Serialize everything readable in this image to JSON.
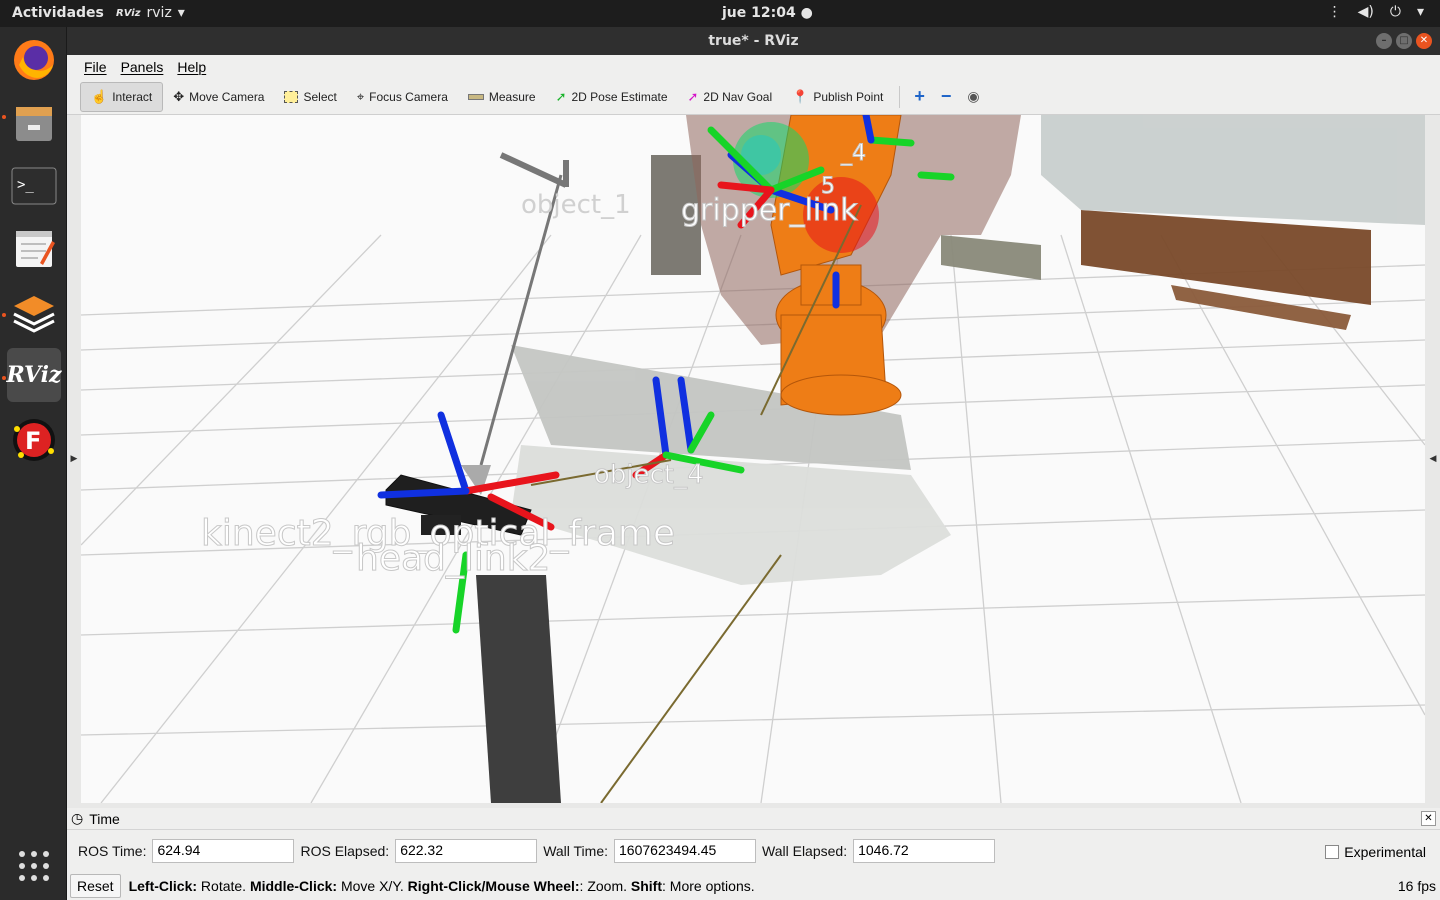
{
  "topbar": {
    "activities": "Actividades",
    "app_name": "rviz",
    "app_icon_text": "RViz",
    "clock": "jue 12:04 ●",
    "tray": [
      "network-icon",
      "volume-icon",
      "power-icon",
      "chevron-down-icon"
    ]
  },
  "dock": {
    "apps": [
      "firefox",
      "files",
      "terminal",
      "text-editor",
      "ros-layers",
      "rviz",
      "fcitx"
    ],
    "rviz_label": "RViz",
    "fcitx_label": "F"
  },
  "window": {
    "title": "true* - RViz"
  },
  "menu": {
    "file": "File",
    "panels": "Panels",
    "help": "Help"
  },
  "toolbar": {
    "interact": "Interact",
    "move_camera": "Move Camera",
    "select": "Select",
    "focus_camera": "Focus Camera",
    "measure": "Measure",
    "pose_estimate": "2D Pose Estimate",
    "nav_goal": "2D Nav Goal",
    "publish_point": "Publish Point"
  },
  "scene": {
    "labels": {
      "object_1": "object_1",
      "object_4": "object_4",
      "kinect": "kinect2_rgb_optical_frame",
      "head_link": "head_link2",
      "gripper": "gripper_link",
      "frame_4": "_4",
      "frame_5": "5"
    },
    "colors": {
      "robot": "#ee7d16",
      "x_axis": "#e8141c",
      "y_axis": "#17d428",
      "z_axis": "#1030e0",
      "grid": "#d0d0d0"
    }
  },
  "time_panel": {
    "title": "Time",
    "ros_time_label": "ROS Time:",
    "ros_time": "624.94",
    "ros_elapsed_label": "ROS Elapsed:",
    "ros_elapsed": "622.32",
    "wall_time_label": "Wall Time:",
    "wall_time": "1607623494.45",
    "wall_elapsed_label": "Wall Elapsed:",
    "wall_elapsed": "1046.72",
    "experimental": "Experimental"
  },
  "status": {
    "reset": "Reset",
    "left_click": "Left-Click:",
    "left_click_text": " Rotate. ",
    "middle_click": "Middle-Click:",
    "middle_click_text": " Move X/Y. ",
    "right_click": "Right-Click/Mouse Wheel:",
    "right_click_text": ": Zoom. ",
    "shift": "Shift",
    "shift_text": ": More options.",
    "fps": "16 fps"
  }
}
